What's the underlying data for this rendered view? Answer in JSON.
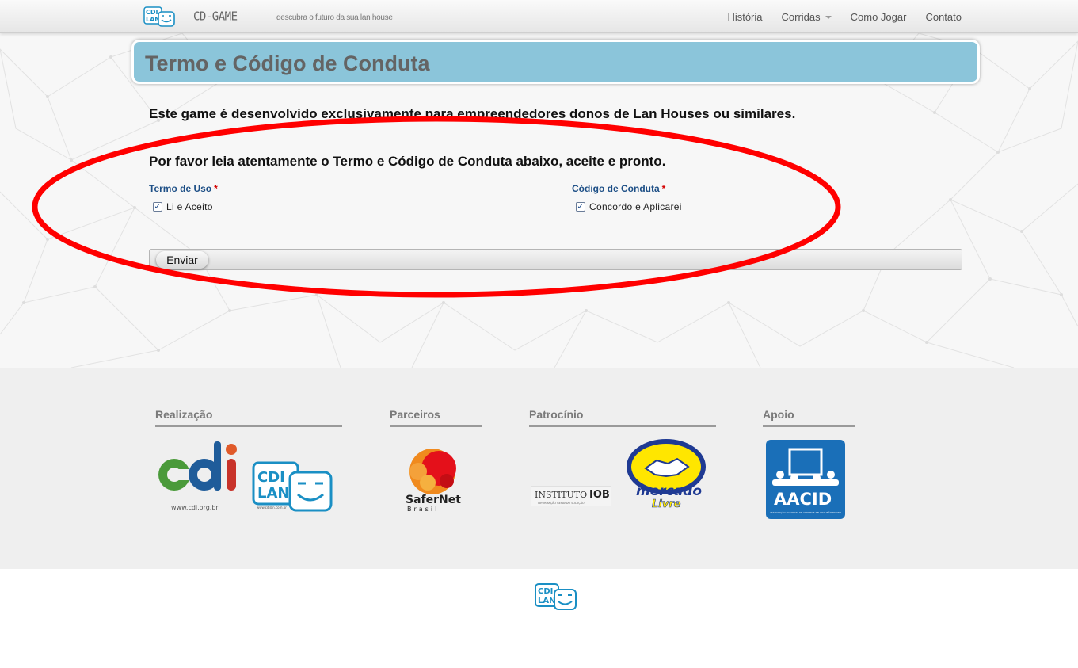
{
  "brand": {
    "logo_line1": "CDI",
    "logo_line2": "LAN",
    "name": "CD-GAME",
    "tagline": "descubra o futuro da sua lan house"
  },
  "nav": {
    "items": [
      {
        "label": "História"
      },
      {
        "label": "Corridas"
      },
      {
        "label": "Como Jogar"
      },
      {
        "label": "Contato"
      }
    ]
  },
  "page": {
    "title": "Termo e Código de Conduta",
    "intro": "Este game é desenvolvido exclusivamente para empreendedores donos de Lan Houses ou similares.",
    "instructions": "Por favor leia atentamente o Termo e Código de Conduta abaixo, aceite e pronto."
  },
  "form": {
    "terms": {
      "label": "Termo de Uso",
      "required_mark": "*",
      "checkbox_label": "Li e Aceito",
      "checked": true
    },
    "conduct": {
      "label": "Código de Conduta",
      "required_mark": "*",
      "checkbox_label": "Concordo e Aplicarei",
      "checked": true
    },
    "submit_label": "Enviar"
  },
  "footer": {
    "sections": [
      {
        "title": "Realização"
      },
      {
        "title": "Parceiros"
      },
      {
        "title": "Patrocínio"
      },
      {
        "title": "Apoio"
      }
    ],
    "logos": {
      "cdi": {
        "url_text": "www.cdi.org.br"
      },
      "cdilan": {
        "line1": "CDI",
        "line2": "LAN",
        "url_text": "www.cdilan.com.br"
      },
      "safernet": {
        "line1": "SaferNet",
        "line2": "Brasil"
      },
      "iob": {
        "name": "INSTITUTO",
        "mark": "IOB",
        "sub": "INFORMAÇÃO GERANDO SOLUÇÃO"
      },
      "mercado": {
        "line1": "mercado",
        "line2": "Livre"
      },
      "aacid": {
        "name": "AACID",
        "sub": "ASSOCIAÇÃO NACIONAL DE CENTROS DE INCLUSÃO DIGITAL"
      }
    }
  },
  "colors": {
    "banner": "#8bc5da",
    "label_blue": "#1d4f86",
    "required_red": "#d40000",
    "annotation_red": "#ff0000",
    "cdilan_blue": "#1a8fc4"
  }
}
